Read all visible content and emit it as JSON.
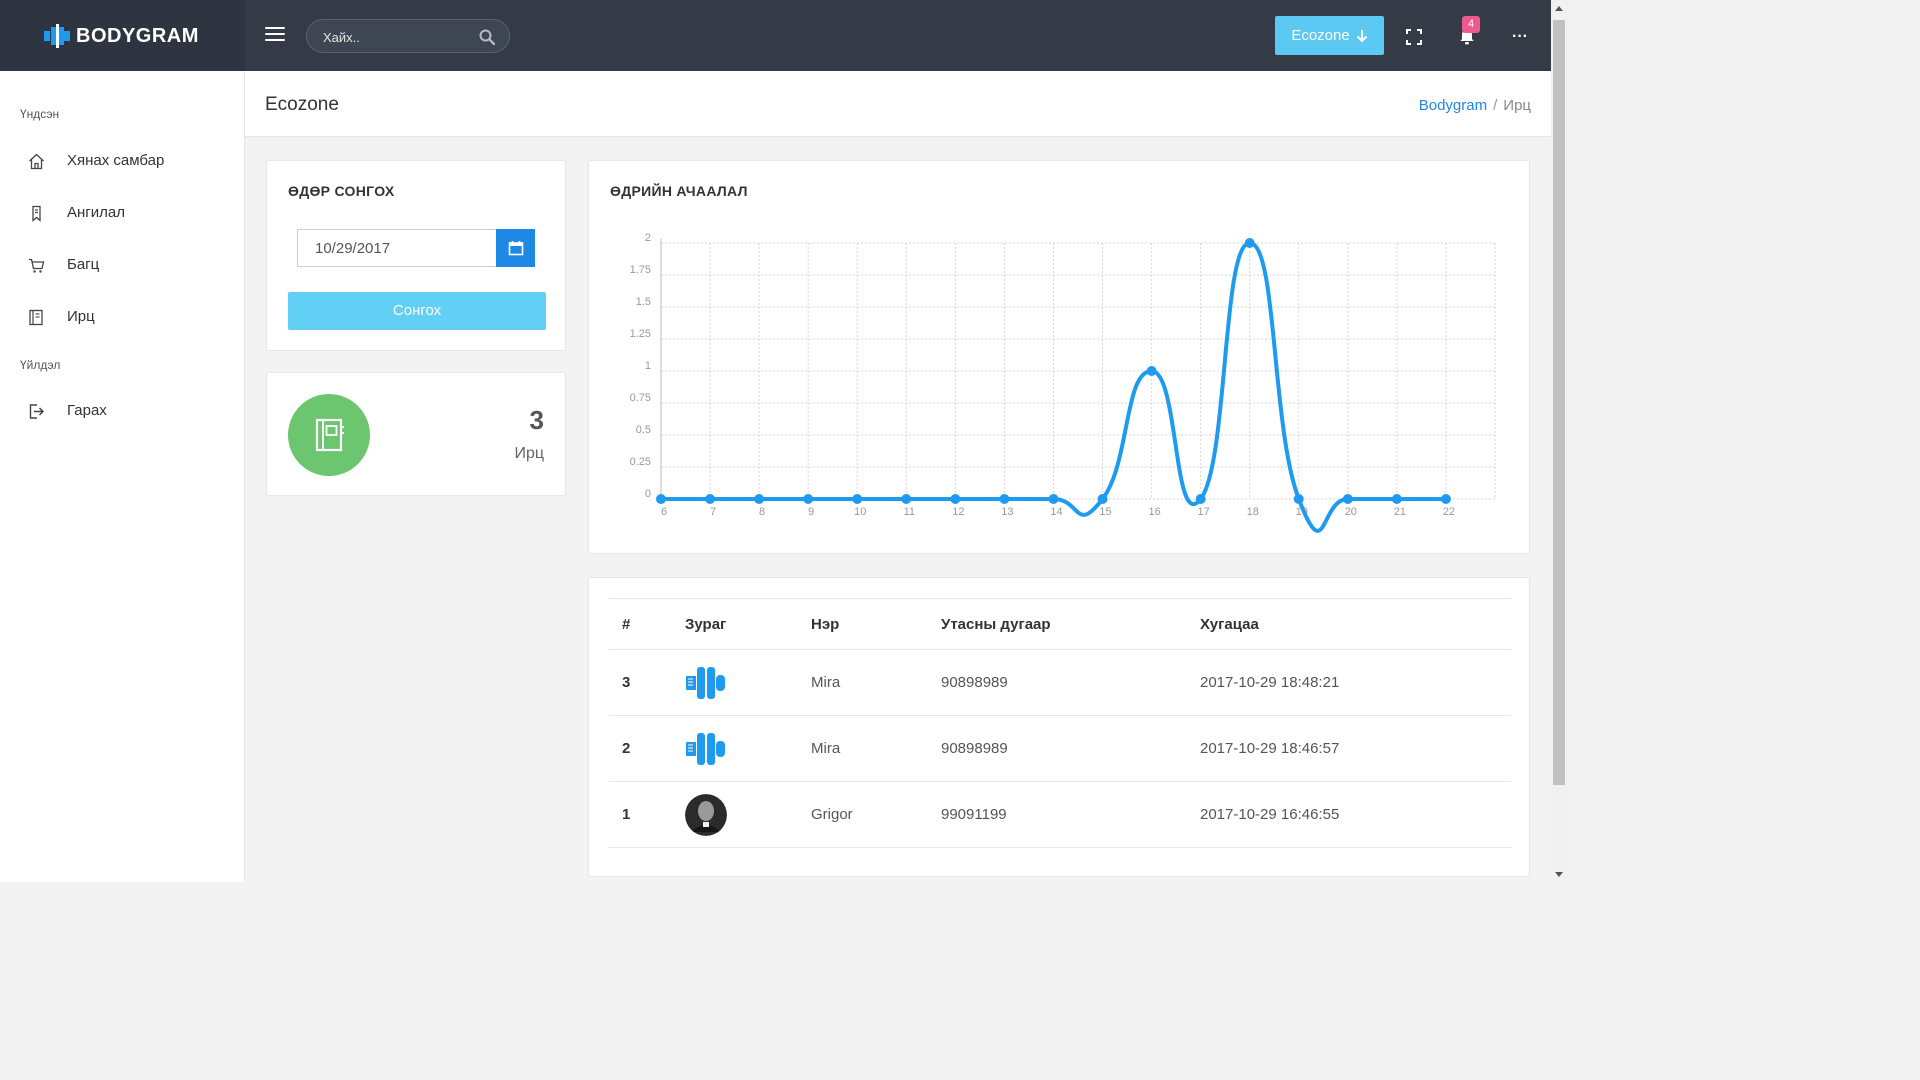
{
  "brand": {
    "name": "BODYGRAM"
  },
  "search": {
    "placeholder": "Хайх.."
  },
  "topbar": {
    "org_button": "Ecozone",
    "notification_count": "4"
  },
  "sidebar": {
    "section_main": "Үндсэн",
    "section_actions": "Үйлдэл",
    "items": [
      {
        "label": "Хянах самбар",
        "icon": "home-icon"
      },
      {
        "label": "Ангилал",
        "icon": "bookmark-icon"
      },
      {
        "label": "Багц",
        "icon": "cart-icon"
      },
      {
        "label": "Ирц",
        "icon": "notebook-icon"
      }
    ],
    "logout": {
      "label": "Гарах",
      "icon": "logout-icon"
    }
  },
  "page": {
    "title": "Ecozone",
    "breadcrumb": {
      "home": "Bodygram",
      "separator": "/",
      "current": "Ирц"
    }
  },
  "date_card": {
    "title": "ӨДӨР СОНГОХ",
    "date_value": "10/29/2017",
    "button": "Сонгох"
  },
  "stat_card": {
    "value": "3",
    "label": "Ирц",
    "color": "#6cc56f"
  },
  "chart_card": {
    "title": "ӨДРИЙН АЧААЛАЛ"
  },
  "chart_data": {
    "type": "line",
    "x": [
      6,
      7,
      8,
      9,
      10,
      11,
      12,
      13,
      14,
      15,
      16,
      17,
      18,
      19,
      20,
      21,
      22
    ],
    "series": [
      {
        "values": [
          0,
          0,
          0,
          0,
          0,
          0,
          0,
          0,
          0,
          0,
          1,
          0,
          2,
          0,
          0,
          0,
          0
        ],
        "color": "#1e9bef"
      }
    ],
    "yticks": [
      "0",
      "0.25",
      "0.5",
      "0.75",
      "1",
      "1.25",
      "1.5",
      "1.75",
      "2"
    ],
    "ylim": [
      0,
      2
    ],
    "xlim": [
      6,
      23
    ],
    "grid": true,
    "smooth": true
  },
  "table": {
    "headers": [
      "#",
      "Зураг",
      "Нэр",
      "Утасны дугаар",
      "Хугацаа"
    ],
    "rows": [
      {
        "num": "3",
        "avatar": "logo",
        "name": "Mira",
        "phone": "90898989",
        "time": "2017-10-29 18:48:21"
      },
      {
        "num": "2",
        "avatar": "logo",
        "name": "Mira",
        "phone": "90898989",
        "time": "2017-10-29 18:46:57"
      },
      {
        "num": "1",
        "avatar": "photo",
        "name": "Grigor",
        "phone": "99091199",
        "time": "2017-10-29 16:46:55"
      }
    ]
  },
  "colors": {
    "topbar": "#343a46",
    "accent": "#1e88e5",
    "button_light": "#62cff5",
    "badge": "#ef5a8d"
  }
}
